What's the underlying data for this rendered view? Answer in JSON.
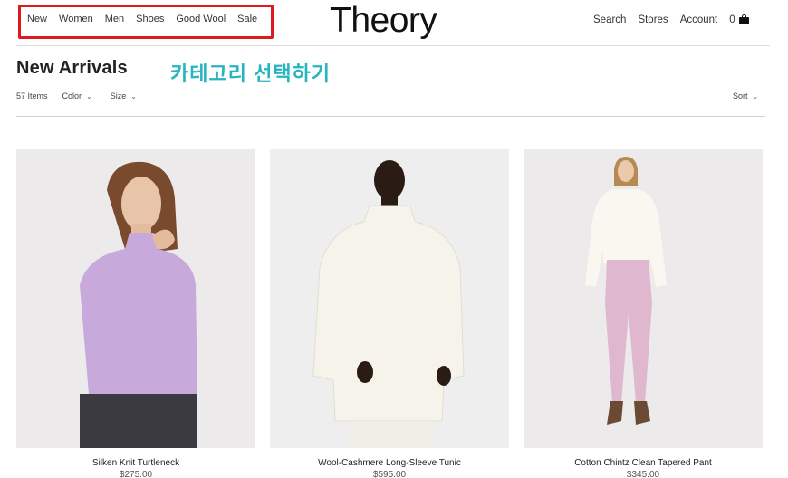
{
  "nav": {
    "items": [
      "New",
      "Women",
      "Men",
      "Shoes",
      "Good Wool",
      "Sale"
    ]
  },
  "brand": {
    "logo": "Theory"
  },
  "utility": {
    "search": "Search",
    "stores": "Stores",
    "account": "Account",
    "bag_count": "0"
  },
  "page": {
    "title": "New Arrivals",
    "annotation": "카테고리 선택하기"
  },
  "filters": {
    "count": "57 Items",
    "color": "Color",
    "size": "Size",
    "sort": "Sort"
  },
  "products": [
    {
      "name": "Silken Knit Turtleneck",
      "price": "$275.00"
    },
    {
      "name": "Wool-Cashmere Long-Sleeve Tunic",
      "price": "$595.00"
    },
    {
      "name": "Cotton Chintz Clean Tapered Pant",
      "price": "$345.00"
    }
  ],
  "colors": {
    "annotation_text": "#27b5bf",
    "highlight_border": "#e0191f"
  }
}
